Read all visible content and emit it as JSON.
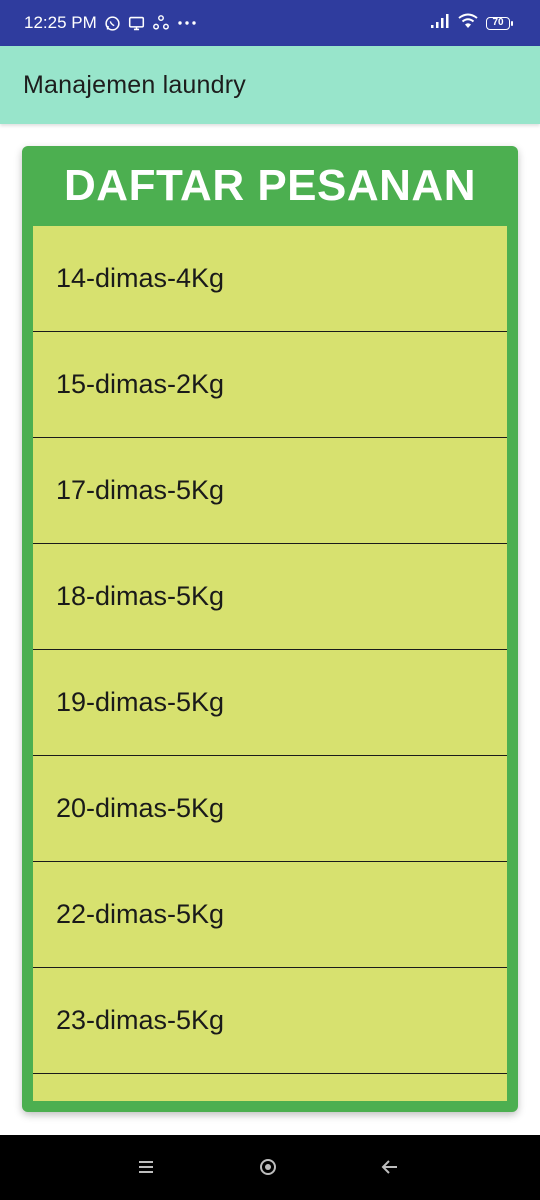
{
  "status_bar": {
    "time": "12:25 PM",
    "icons_left": [
      "whatsapp-icon",
      "screen-icon",
      "sync-icon",
      "more-dots-icon"
    ],
    "icons_right": [
      "signal-icon",
      "wifi-icon",
      "battery-icon"
    ],
    "battery_level": "70"
  },
  "app_bar": {
    "title": "Manajemen laundry",
    "background_color": "#98e5cb"
  },
  "card": {
    "title": "DAFTAR PESANAN",
    "background_color": "#4caf50",
    "list_background_color": "#d7e16f",
    "items": [
      {
        "label": "14-dimas-4Kg"
      },
      {
        "label": "15-dimas-2Kg"
      },
      {
        "label": "17-dimas-5Kg"
      },
      {
        "label": "18-dimas-5Kg"
      },
      {
        "label": "19-dimas-5Kg"
      },
      {
        "label": "20-dimas-5Kg"
      },
      {
        "label": "22-dimas-5Kg"
      },
      {
        "label": "23-dimas-5Kg"
      },
      {
        "label": ""
      }
    ]
  },
  "nav_bar": {
    "buttons": [
      "menu-icon",
      "home-icon",
      "back-icon"
    ]
  }
}
